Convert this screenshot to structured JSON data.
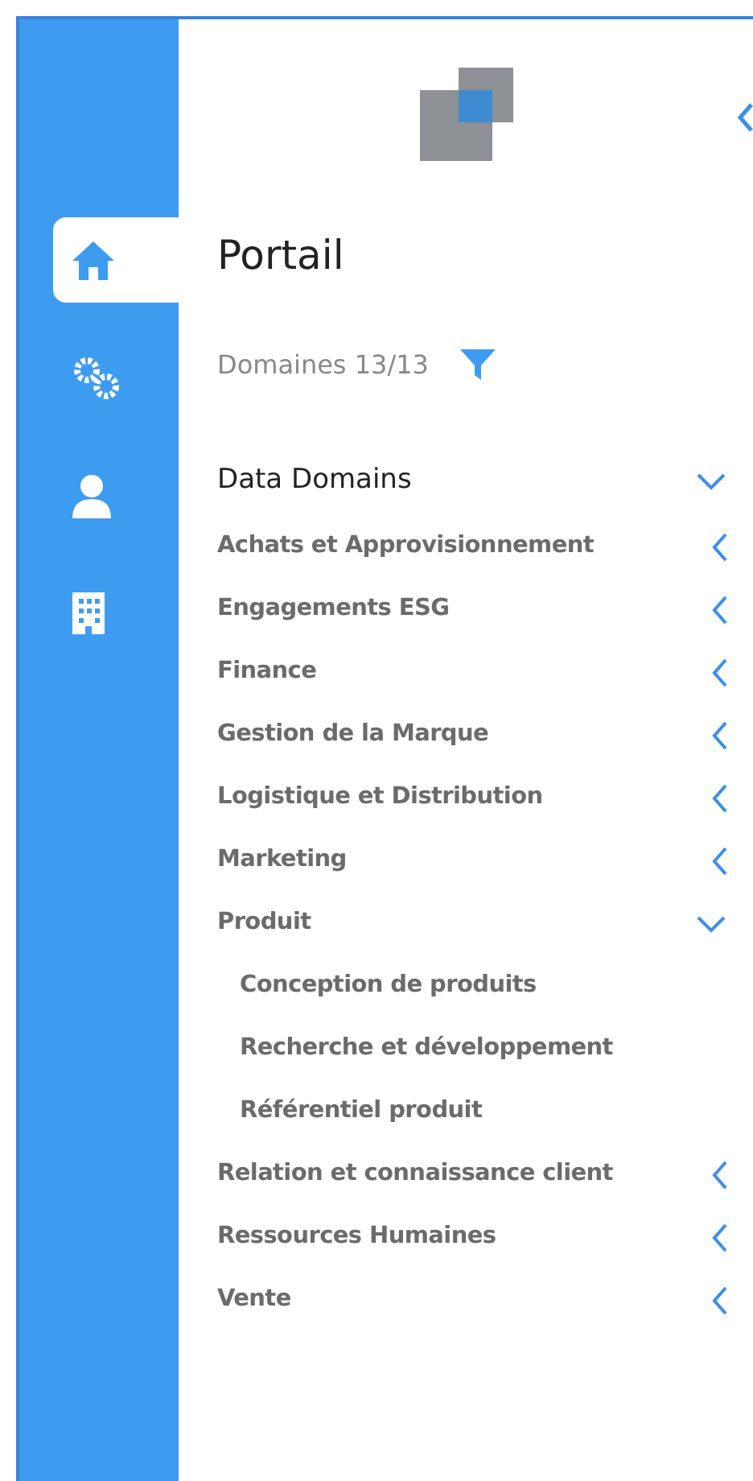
{
  "rail": [
    {
      "kind": "home",
      "selected": true
    },
    {
      "kind": "gears",
      "selected": false
    },
    {
      "kind": "user",
      "selected": false
    },
    {
      "kind": "building",
      "selected": false
    }
  ],
  "title": "Portail",
  "filter": {
    "label": "Domaines 13/13"
  },
  "section": {
    "title": "Data Domains",
    "expanded": true,
    "items": [
      {
        "label": "Achats et Approvisionnement",
        "expanded": false
      },
      {
        "label": "Engagements ESG",
        "expanded": false
      },
      {
        "label": "Finance",
        "expanded": false
      },
      {
        "label": "Gestion de la Marque",
        "expanded": false
      },
      {
        "label": "Logistique et Distribution",
        "expanded": false
      },
      {
        "label": "Marketing",
        "expanded": false
      },
      {
        "label": "Produit",
        "expanded": true,
        "children": [
          {
            "label": "Conception de produits"
          },
          {
            "label": "Recherche et développement"
          },
          {
            "label": "Référentiel produit"
          }
        ]
      },
      {
        "label": "Relation et connaissance client",
        "expanded": false
      },
      {
        "label": "Ressources Humaines",
        "expanded": false
      },
      {
        "label": "Vente",
        "expanded": false
      }
    ]
  }
}
